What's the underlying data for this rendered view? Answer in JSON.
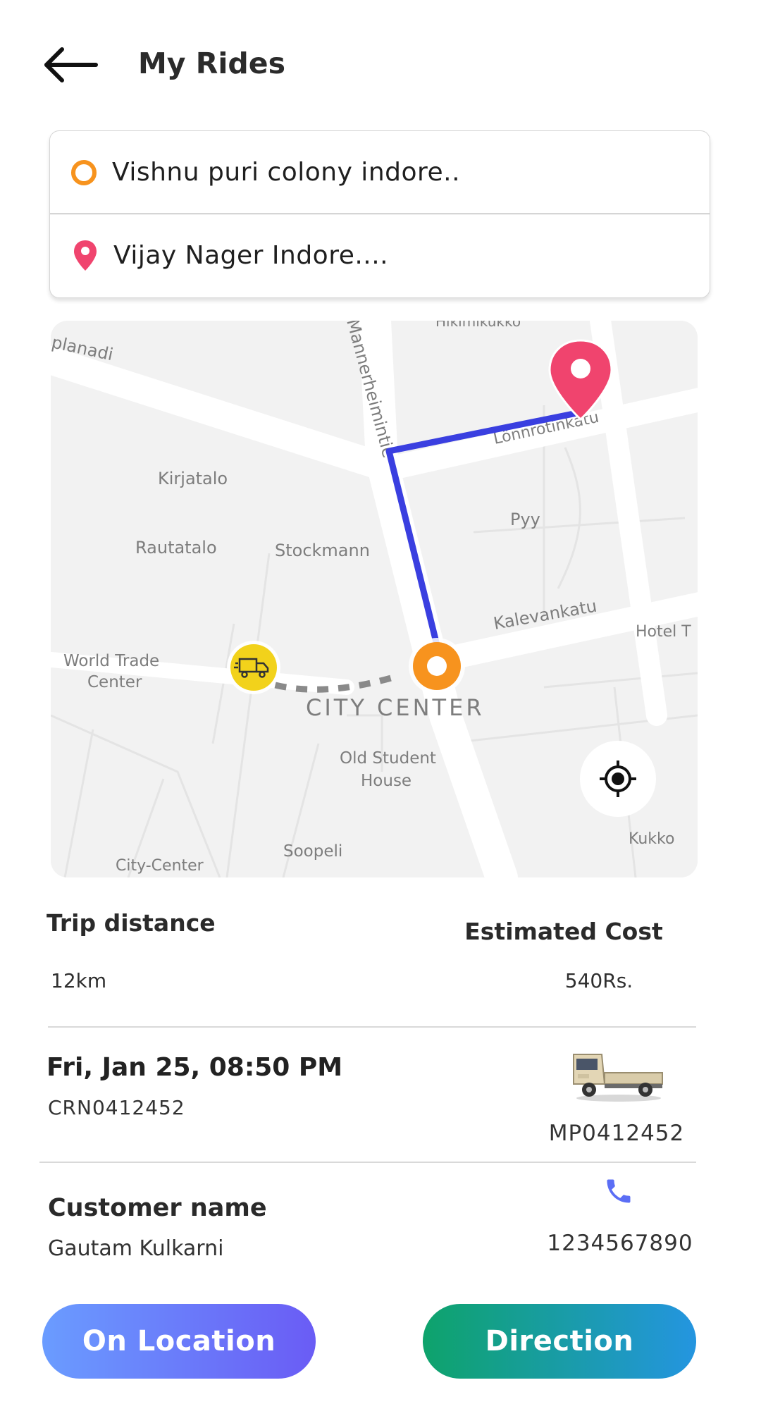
{
  "header": {
    "title": "My Rides",
    "back_icon": "back-arrow-icon"
  },
  "addresses": {
    "pickup": "Vishnu puri colony indore..",
    "drop": "Vijay Nager Indore....",
    "pickup_icon": "pickup-ring-icon",
    "drop_icon": "location-pin-icon"
  },
  "map": {
    "labels": {
      "kirjatalo": "Kirjatalo",
      "rautatalo": "Rautatalo",
      "stockmann": "Stockmann",
      "world_trade_1": "World Trade",
      "world_trade_2": "Center",
      "city_center": "CITY CENTER",
      "old_student_1": "Old Student",
      "old_student_2": "House",
      "soopeli": "Soopeli",
      "city_center_small": "City-Center",
      "pyy": "Pyy",
      "kalevankatu": "Kalevankatu",
      "hotel": "Hotel T",
      "mannerheimintie": "Mannerheimintie",
      "esplanadi": "planadi",
      "lonn": "Lönnrotinkatu",
      "kukko": "Kukko",
      "top": "Hikimikukko"
    },
    "colors": {
      "route": "#3a3fe0",
      "pickup_marker": "#f7931e",
      "drop_marker": "#f0446e",
      "truck_marker": "#f2d21b"
    },
    "locate_icon": "crosshair-locate-icon"
  },
  "trip": {
    "distance_label": "Trip distance",
    "distance_value": "12km",
    "cost_label": "Estimated Cost",
    "cost_value": "540Rs."
  },
  "ride": {
    "date": "Fri, Jan 25, 08:50 PM",
    "crn": "CRN0412452",
    "vehicle_number": "MP0412452",
    "vehicle_icon": "pickup-truck-icon"
  },
  "customer": {
    "label": "Customer name",
    "name": "Gautam Kulkarni",
    "phone": "1234567890",
    "phone_icon": "phone-icon"
  },
  "buttons": {
    "on_location": "On Location",
    "direction": "Direction"
  }
}
